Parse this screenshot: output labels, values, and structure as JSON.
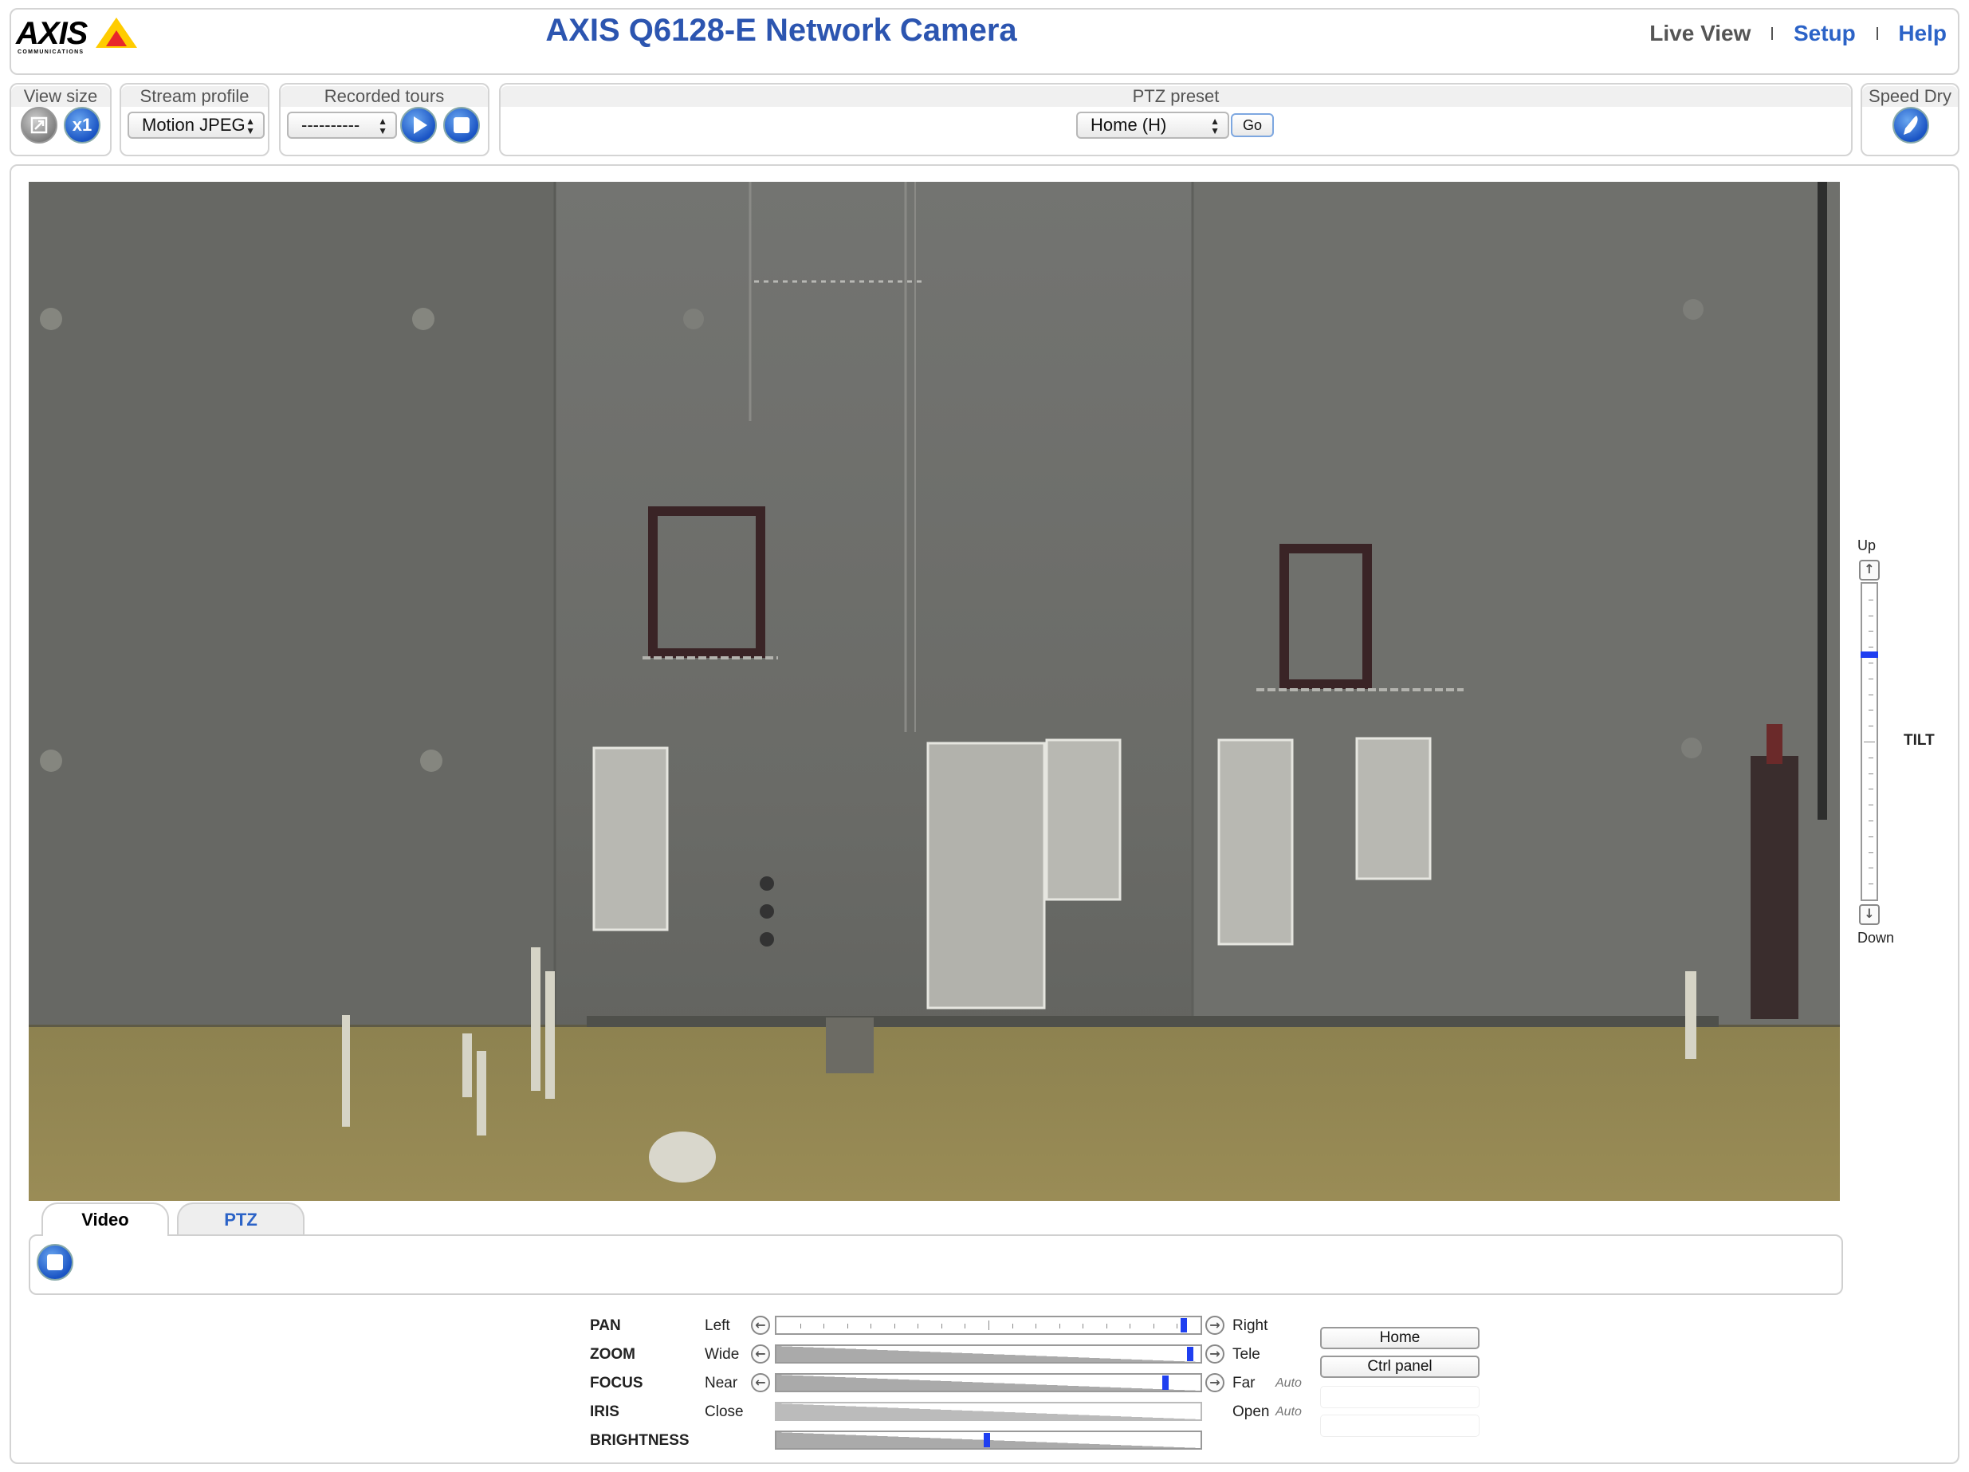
{
  "header": {
    "logo_text": "AXIS",
    "logo_subtext": "COMMUNICATIONS",
    "title": "AXIS Q6128-E Network Camera",
    "nav": {
      "live_view": "Live View",
      "setup": "Setup",
      "help": "Help"
    }
  },
  "toolbar": {
    "view_size": {
      "title": "View size",
      "scale_label": "x1"
    },
    "stream_profile": {
      "title": "Stream profile",
      "selected": "Motion JPEG"
    },
    "recorded_tours": {
      "title": "Recorded tours",
      "selected": "----------"
    },
    "ptz_preset": {
      "title": "PTZ preset",
      "selected": "Home (H)",
      "go_label": "Go"
    },
    "speed_dry": {
      "title": "Speed Dry"
    }
  },
  "tilt": {
    "up_label": "Up",
    "down_label": "Down",
    "title": "TILT",
    "position": 0.22
  },
  "tabs": [
    {
      "label": "Video"
    },
    {
      "label": "PTZ"
    }
  ],
  "controls": {
    "pan": {
      "label": "PAN",
      "left": "Left",
      "right": "Right",
      "value": 0.975
    },
    "zoom": {
      "label": "ZOOM",
      "left": "Wide",
      "right": "Tele",
      "value": 0.99
    },
    "focus": {
      "label": "FOCUS",
      "left": "Near",
      "right": "Far",
      "auto": "Auto",
      "value": 0.93
    },
    "iris": {
      "label": "IRIS",
      "left": "Close",
      "right": "Open",
      "auto": "Auto"
    },
    "brightness": {
      "label": "BRIGHTNESS",
      "value": 0.5
    },
    "buttons": {
      "home": "Home",
      "ctrl_panel": "Ctrl panel"
    }
  }
}
